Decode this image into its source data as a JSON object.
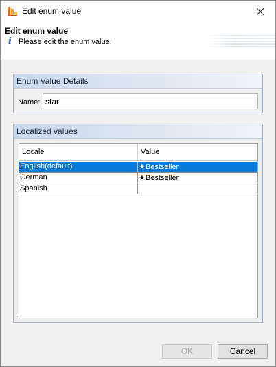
{
  "window": {
    "title": "Edit enum value",
    "icon": "app-stack-icon"
  },
  "header": {
    "title": "Edit enum value",
    "description": "Please edit the enum value.",
    "info_icon": "i"
  },
  "details_group": {
    "title": "Enum Value Details",
    "name_label": "Name:",
    "name_value": "star"
  },
  "localized_group": {
    "title": "Localized values",
    "columns": [
      "Locale",
      "Value"
    ],
    "rows": [
      {
        "locale": "English(default)",
        "star": "★",
        "value": "Bestseller",
        "selected": true
      },
      {
        "locale": "German",
        "star": "★",
        "value": "Bestseller",
        "selected": false
      },
      {
        "locale": "Spanish",
        "star": "",
        "value": "",
        "selected": false
      }
    ]
  },
  "buttons": {
    "ok": "OK",
    "cancel": "Cancel"
  },
  "colors": {
    "selection": "#0a78d7",
    "group_header": "#c8d6ea"
  }
}
